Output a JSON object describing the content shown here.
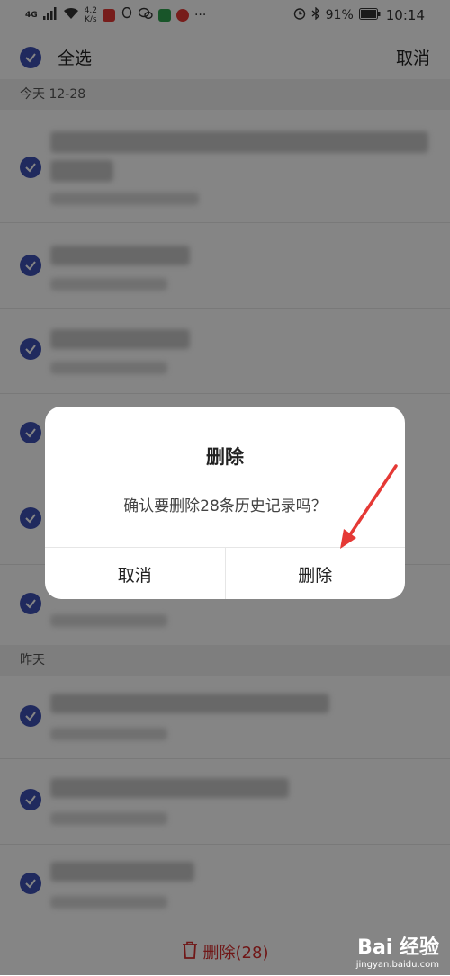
{
  "status_bar": {
    "network": "4G",
    "speed_value": "4.2",
    "speed_unit": "K/s",
    "more": "···",
    "battery": "91%",
    "time": "10:14",
    "icons": [
      "signal-icon",
      "wifi-icon",
      "mic-app-icon",
      "qq-icon",
      "wechat-icon",
      "video-app-icon",
      "red-app-icon",
      "alarm-icon",
      "bluetooth-icon",
      "battery-icon"
    ]
  },
  "toolbar": {
    "select_all": "全选",
    "cancel": "取消"
  },
  "sections": [
    {
      "label": "今天  12-28"
    },
    {
      "label": "昨天"
    }
  ],
  "list": {
    "item_count": 9
  },
  "bottom": {
    "delete_label": "删除(28)"
  },
  "dialog": {
    "title": "删除",
    "message": "确认要删除28条历史记录吗？",
    "cancel": "取消",
    "confirm": "删除"
  },
  "watermark": {
    "logo": "Bai 经验",
    "site": "jingyan.baidu.com"
  },
  "colors": {
    "accent": "#3f51b5",
    "danger": "#d62c2c",
    "arrow": "#e53935"
  }
}
